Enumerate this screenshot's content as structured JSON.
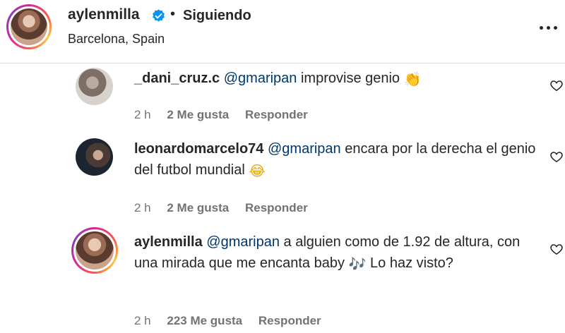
{
  "post_header": {
    "username": "aylenmilla",
    "separator": "•",
    "follow_status": "Siguiendo",
    "location": "Barcelona, Spain",
    "verified_icon": "verified-badge-icon",
    "more_icon": "more-options-icon"
  },
  "comments": [
    {
      "username": "_dani_cruz.c",
      "mention": "@gmaripan",
      "text": "improvise genio",
      "emoji": "👏",
      "time": "2 h",
      "likes": "2 Me gusta",
      "reply": "Responder"
    },
    {
      "username": "leonardomarcelo74",
      "mention": "@gmaripan",
      "text": "encara por la derecha el genio del futbol mundial",
      "emoji": "😂",
      "time": "2 h",
      "likes": "2 Me gusta",
      "reply": "Responder"
    },
    {
      "username": "aylenmilla",
      "mention": "@gmaripan",
      "text": "a alguien como de 1.92 de altura, con una mirada que me encanta baby",
      "emoji": "🎶",
      "text_after": "Lo haz visto?",
      "time": "2 h",
      "likes": "223 Me gusta",
      "reply": "Responder"
    }
  ],
  "colors": {
    "text": "#262626",
    "mention": "#00376b",
    "meta": "#737373",
    "verified": "#0095f6"
  }
}
